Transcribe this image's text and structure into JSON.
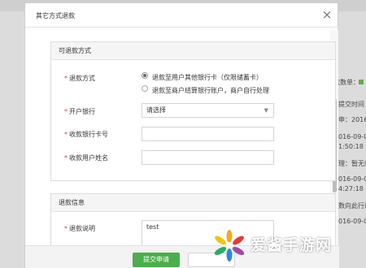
{
  "background": {
    "left_fragments": [
      "退",
      "申"
    ],
    "right_fragments": {
      "refund_order_label": "款数单：",
      "submit_time_header": "提交时间",
      "entries": [
        "申：2016-",
        "016-09-0",
        "1:50:18",
        "理：暂无款",
        "016-09-0",
        "4:27:18",
        "数向此行退",
        "016-09-0"
      ]
    }
  },
  "modal": {
    "title": "其它方式退款",
    "close_symbol": "×",
    "section1": {
      "heading": "可退款方式",
      "refund_method_label": "退款方式",
      "option_user_card": "退款至用户其他银行卡（仅限储蓄卡）",
      "option_merchant_account": "退款至商户结算银行账户，商户自行处理",
      "bank_label": "开户银行",
      "bank_select_value": "请选择",
      "card_number_label": "收款银行卡号",
      "card_number_value": "",
      "account_name_label": "收款用户姓名",
      "account_name_value": ""
    },
    "section2": {
      "heading": "退款信息",
      "note_label": "退款说明",
      "note_value": "test"
    },
    "footer": {
      "submit_label": "提交申请",
      "cancel_label": ""
    }
  },
  "watermark": {
    "brand_text": "爱酱手游网"
  },
  "colors": {
    "accent_green": "#4cae4c",
    "required_star": "#e4393c"
  }
}
